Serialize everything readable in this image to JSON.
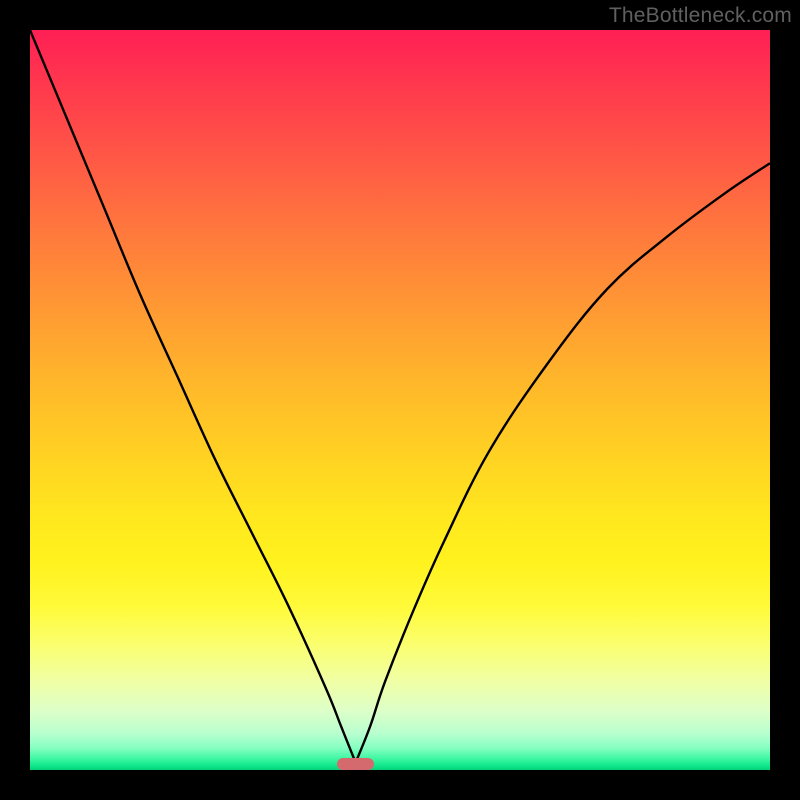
{
  "watermark": "TheBottleneck.com",
  "colors": {
    "frame": "#000000",
    "watermark_text": "#606060",
    "curve_stroke": "#000000",
    "marker": "#d56a6e",
    "gradient_stops": [
      "#ff1f55",
      "#ff3a4d",
      "#ff5a45",
      "#ff7b3c",
      "#ff9a33",
      "#ffb82a",
      "#ffd322",
      "#ffe81e",
      "#fff21e",
      "#fffa3a",
      "#fbff6e",
      "#f0ffa5",
      "#ddffc8",
      "#b9ffcf",
      "#86ffc1",
      "#3cf7a2",
      "#10e88d",
      "#04d278"
    ]
  },
  "chart_data": {
    "type": "line",
    "title": "",
    "xlabel": "",
    "ylabel": "",
    "xlim": [
      0,
      100
    ],
    "ylim": [
      0,
      100
    ],
    "grid": false,
    "legend": false,
    "notes": "Axes are unlabeled percentage-style scales (0–100). Two monotone curves descend from the top edge and meet near the bottom around x≈44 where a small rounded marker sits. Values estimated from pixel positions.",
    "series": [
      {
        "name": "left-curve",
        "x": [
          0,
          5,
          10,
          15,
          20,
          25,
          30,
          35,
          40,
          42,
          44
        ],
        "y": [
          100,
          88,
          76,
          64,
          53,
          42,
          32,
          22,
          11,
          6,
          1
        ]
      },
      {
        "name": "right-curve",
        "x": [
          44,
          46,
          48,
          52,
          56,
          62,
          70,
          78,
          86,
          94,
          100
        ],
        "y": [
          1,
          6,
          12,
          22,
          31,
          43,
          55,
          65,
          72,
          78,
          82
        ]
      }
    ],
    "marker": {
      "x_center": 44,
      "x_half_width": 2.5,
      "y": 0.8
    }
  }
}
